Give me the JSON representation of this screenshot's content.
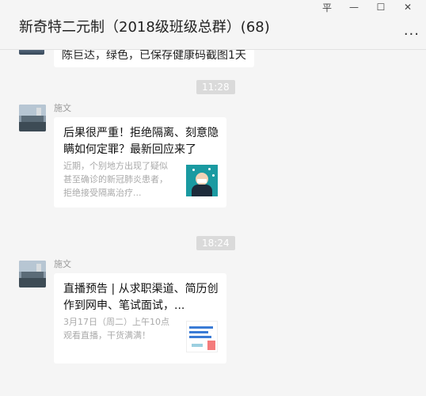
{
  "window": {
    "title": "新奇特二元制（2018级班级总群）(68)",
    "controls": [
      "平",
      "—",
      "☐",
      "✕"
    ],
    "more": "..."
  },
  "messages": [
    {
      "type": "text",
      "text": "陈巨达，绿色，已保存健康码截图1天"
    },
    {
      "type": "time",
      "text": "11:28"
    },
    {
      "type": "card",
      "sender": "施文",
      "title": "后果很严重！拒绝隔离、刻意隐瞒如何定罪？最新回应来了",
      "desc": "近期，个别地方出现了疑似甚至确诊的新冠肺炎患者，拒绝接受隔离治疗..."
    },
    {
      "type": "time",
      "text": "18:24"
    },
    {
      "type": "card",
      "sender": "施文",
      "title": "直播预告 | 从求职渠道、简历创作到网申、笔试面试，...",
      "desc": "3月17日（周二）上午10点观看直播，干货满满！"
    }
  ]
}
